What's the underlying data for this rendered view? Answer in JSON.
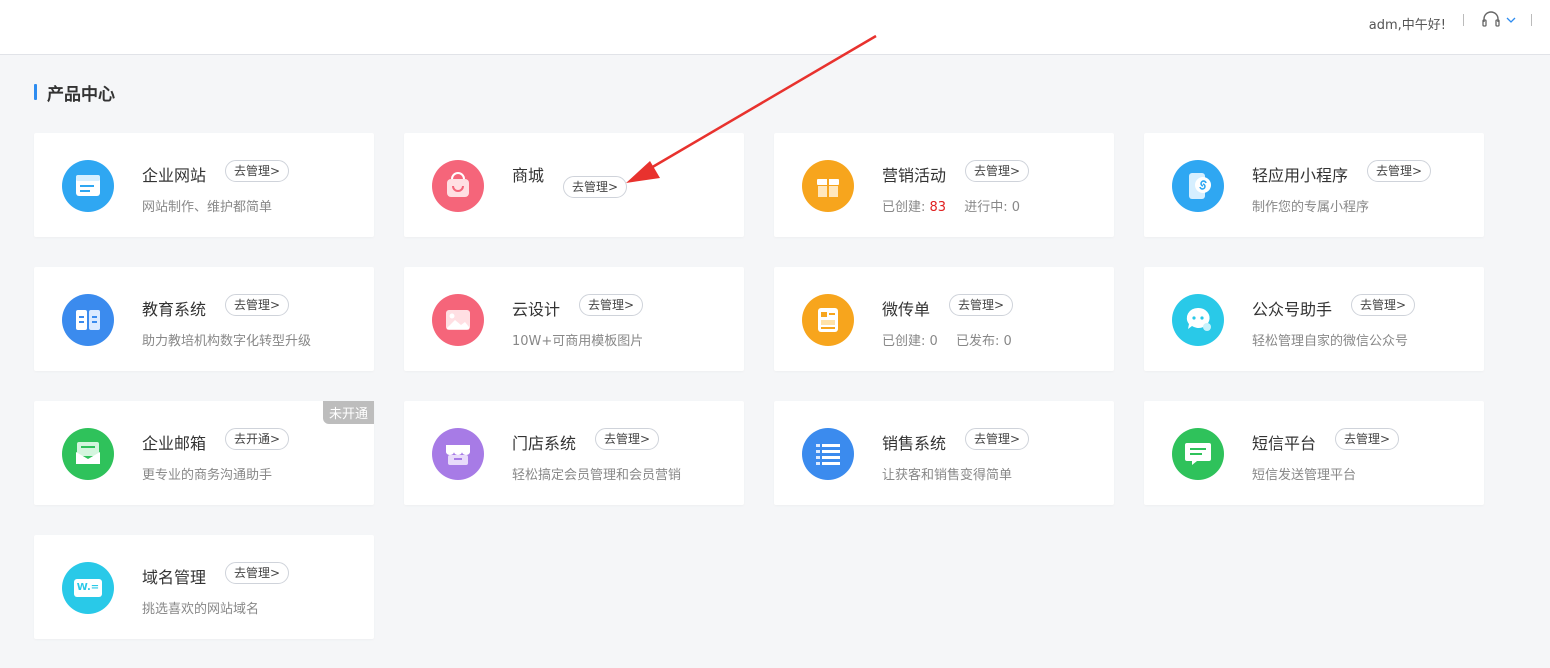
{
  "header": {
    "greeting": "adm,中午好!"
  },
  "section": {
    "title": "产品中心"
  },
  "cards": {
    "website": {
      "name": "企业网站",
      "button": "去管理>",
      "desc": "网站制作、维护都简单"
    },
    "mall": {
      "name": "商城",
      "button": "去管理>"
    },
    "marketing": {
      "name": "营销活动",
      "button": "去管理>",
      "created_label": "已创建:",
      "created_value": "83",
      "ongoing_label": "进行中:",
      "ongoing_value": "0"
    },
    "miniapp": {
      "name": "轻应用小程序",
      "button": "去管理>",
      "desc": "制作您的专属小程序"
    },
    "education": {
      "name": "教育系统",
      "button": "去管理>",
      "desc": "助力教培机构数字化转型升级"
    },
    "clouddesign": {
      "name": "云设计",
      "button": "去管理>",
      "desc": "10W+可商用模板图片"
    },
    "flyer": {
      "name": "微传单",
      "button": "去管理>",
      "created_label": "已创建:",
      "created_value": "0",
      "published_label": "已发布:",
      "published_value": "0"
    },
    "wechat": {
      "name": "公众号助手",
      "button": "去管理>",
      "desc": "轻松管理自家的微信公众号"
    },
    "mail": {
      "name": "企业邮箱",
      "button": "去开通>",
      "desc": "更专业的商务沟通助手",
      "tag": "未开通"
    },
    "store": {
      "name": "门店系统",
      "button": "去管理>",
      "desc": "轻松搞定会员管理和会员营销"
    },
    "sales": {
      "name": "销售系统",
      "button": "去管理>",
      "desc": "让获客和销售变得简单"
    },
    "sms": {
      "name": "短信平台",
      "button": "去管理>",
      "desc": "短信发送管理平台"
    },
    "domain": {
      "name": "域名管理",
      "button": "去管理>",
      "desc": "挑选喜欢的网站域名",
      "icon_text": "W.="
    }
  },
  "colors": {
    "accent": "#2d8cf0",
    "blue": "#2fa7f2",
    "pink": "#f5657a",
    "orange": "#f7a51d",
    "green": "#2fc25b",
    "purple": "#a77be6",
    "cyan": "#29c9e8",
    "arrow": "#e8322e"
  }
}
